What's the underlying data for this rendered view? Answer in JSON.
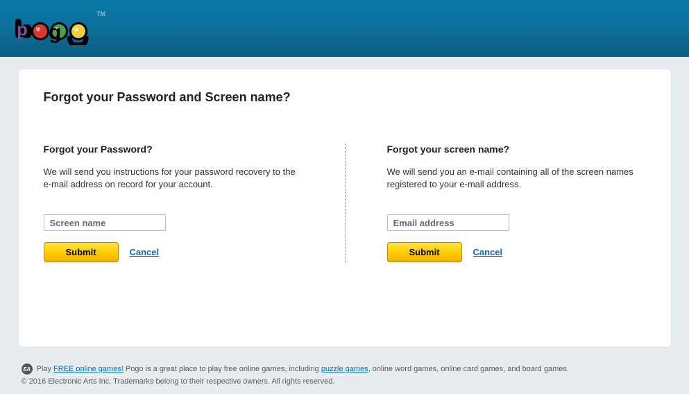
{
  "header": {
    "brand": "pogo",
    "tm": "TM"
  },
  "page_title": "Forgot your Password and Screen name?",
  "password": {
    "title": "Forgot your Password?",
    "text": "We will send you instructions for your password recovery to the e-mail address on record for your account.",
    "input_placeholder": "Screen name",
    "submit": "Submit",
    "cancel": "Cancel"
  },
  "screenname": {
    "title": "Forgot your screen name?",
    "text": "We will send you an e-mail containing all of the screen names registered to your e-mail address.",
    "input_placeholder": "Email address",
    "submit": "Submit",
    "cancel": "Cancel"
  },
  "footer": {
    "ea": "EA",
    "play": "Play ",
    "free_games": "FREE online games!",
    "mid1": " Pogo is a great place to play free online games, including ",
    "puzzle": "puzzle games",
    "mid2": ", online word games, online card games, and board games.",
    "copyright": "© 2016 Electronic Arts Inc. Trademarks belong to their respective owners. All rights reserved."
  }
}
